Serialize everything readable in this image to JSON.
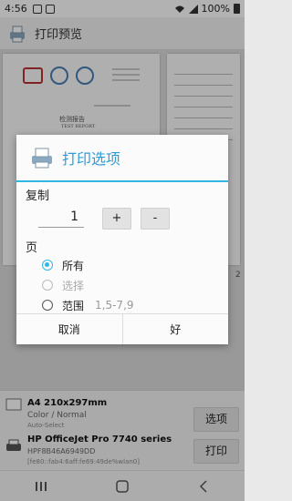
{
  "status_bar": {
    "time": "4:56",
    "battery": "100%"
  },
  "app_bar": {
    "title": "打印预览"
  },
  "preview": {
    "report_title_cn": "检测报告",
    "report_title_en": "TEST REPORT",
    "page_number": "2"
  },
  "dialog": {
    "title": "打印选项",
    "copies_label": "复制",
    "copies_value": "1",
    "plus_label": "+",
    "minus_label": "-",
    "pages_label": "页",
    "options": [
      {
        "label": "所有",
        "state": "checked"
      },
      {
        "label": "选择",
        "state": "disabled"
      },
      {
        "label": "范围",
        "state": "unchecked"
      }
    ],
    "range_placeholder": "1,5-7,9",
    "cancel_label": "取消",
    "ok_label": "好",
    "accent_color": "#33b5e5"
  },
  "bottom": {
    "paper_size": "A4 210x297mm",
    "color_mode": "Color / Normal",
    "source": "Auto-Select",
    "printer_name": "HP OfficeJet Pro 7740 series",
    "printer_id": "HPF8B46A6949DD",
    "printer_addr": "[fe80::fab4:6aff:fe69:49de%wlan0]",
    "options_button": "选项",
    "print_button": "打印"
  }
}
